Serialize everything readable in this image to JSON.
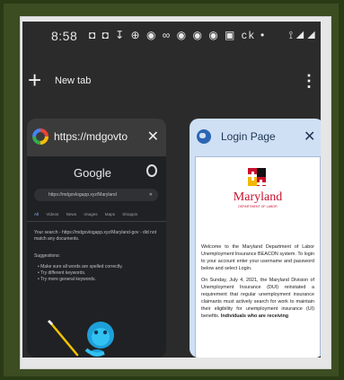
{
  "status_bar": {
    "time": "8:58",
    "icons_text": "◘ ◘ ↧ ⊕ ◉ ∞ ◉ ◉ ◉ ▣ ck •",
    "right_icons": "⟟ ◢ ◢"
  },
  "toolbar": {
    "new_tab_label": "New tab",
    "plus_glyph": "+",
    "menu_glyph": "⋮"
  },
  "tab1": {
    "url": "https://mdgovto",
    "close_glyph": "✕",
    "google_word": "Google",
    "search_query": "https://mdgovlogapp.xyz/Maryland",
    "search_clear": "✕",
    "result_tabs": [
      "All",
      "Videos",
      "News",
      "Images",
      "Maps",
      "Shoppin"
    ],
    "no_match_text": "Your search - https://mdgovlogapp.xyz/Maryland-gov - did not match any documents.",
    "suggestions_heading": "Suggestions:",
    "suggestions": [
      "• Make sure all words are spelled correctly.",
      "• Try different keywords.",
      "• Try more general keywords."
    ]
  },
  "tab2": {
    "title": "Login Page",
    "close_glyph": "✕",
    "logo_word": "Maryland",
    "logo_sub": "DEPARTMENT OF LABOR",
    "para1": "Welcome to the Maryland Department of Labor Unemployment Insurance BEACON system. To login to your account enter your username and password below and select Login.",
    "para2": "On Sunday, July 4, 2021, the Maryland Division of Unemployment Insurance (DUI) reinstated a requirement that regular unemployment insurance claimants must actively search for work to maintain their eligibility for unemployment insurance (UI) benefits.",
    "para2_bold": "Individuals who are receiving"
  },
  "colors": {
    "background": "#2a3a14",
    "mat": "#e6e6e6",
    "phone_bg": "#2b2b2b",
    "tab2_header": "#cfe0f5",
    "maryland_red": "#c8102e",
    "maryland_gold": "#f2b705",
    "google_link_blue": "#8ab4f8"
  }
}
